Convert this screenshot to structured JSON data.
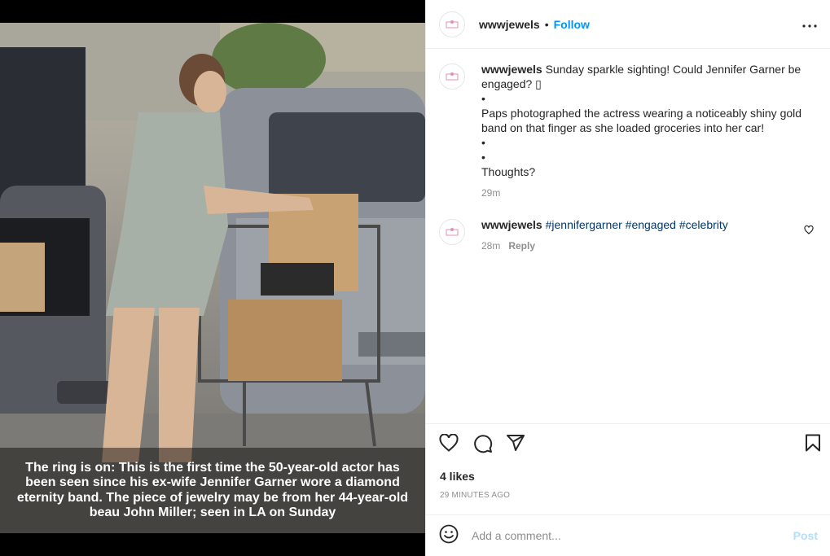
{
  "post": {
    "username": "wwwjewels",
    "separator": "•",
    "follow_label": "Follow",
    "more_icon": "more-horizontal-icon",
    "image_caption": "The ring is on: This is the first time the 50-year-old actor has been seen since his ex-wife Jennifer Garner wore a diamond eternity band. The piece of jewelry may be from her 44-year-old beau John Miller; seen in LA on Sunday"
  },
  "caption_comment": {
    "username": "wwwjewels",
    "lines": [
      "Sunday sparkle sighting! Could Jennifer Garner be engaged? ▯",
      "•",
      "Paps photographed the actress wearing a noticeably shiny gold band on that finger as she loaded groceries into her car!",
      "•",
      "•",
      "Thoughts?"
    ],
    "time": "29m"
  },
  "hashtag_comment": {
    "username": "wwwjewels",
    "tags": [
      "#jennifergarner",
      "#engaged",
      "#celebrity"
    ],
    "time": "28m",
    "reply_label": "Reply"
  },
  "actions": {
    "likes": "4 likes",
    "time_ago": "29 MINUTES AGO"
  },
  "add_comment": {
    "placeholder": "Add a comment...",
    "post_label": "Post"
  },
  "colors": {
    "accent": "#0095f6",
    "post_disabled": "#b2dffc",
    "hashtag": "#00376b",
    "muted": "#8e8e8e"
  }
}
